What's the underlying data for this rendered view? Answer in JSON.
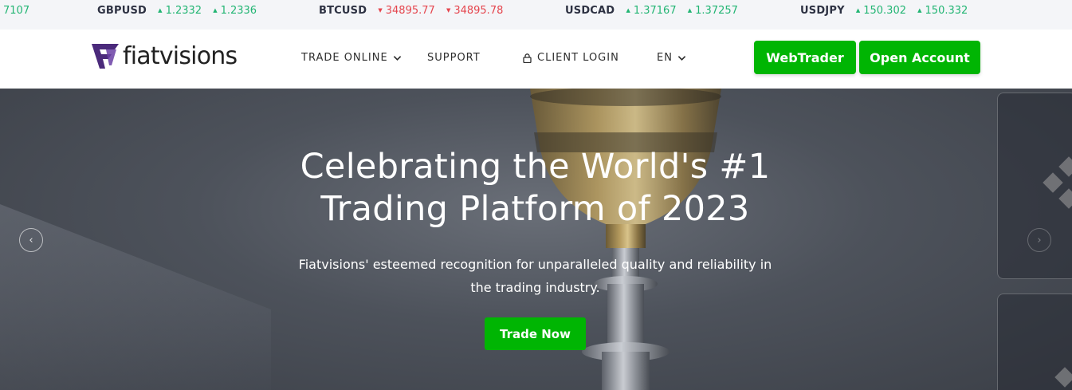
{
  "ticker": {
    "partial": "7107",
    "items": [
      {
        "symbol": "GBPUSD",
        "bid": "1.2332",
        "ask": "1.2336",
        "direction": "up"
      },
      {
        "symbol": "BTCUSD",
        "bid": "34895.77",
        "ask": "34895.78",
        "direction": "down"
      },
      {
        "symbol": "USDCAD",
        "bid": "1.37167",
        "ask": "1.37257",
        "direction": "up"
      },
      {
        "symbol": "USDJPY",
        "bid": "150.302",
        "ask": "150.332",
        "direction": "up"
      }
    ]
  },
  "header": {
    "brand": "fiatvisions",
    "nav": {
      "trade_online": "TRADE ONLINE",
      "support": "SUPPORT",
      "client_login": "CLIENT LOGIN",
      "language": "EN"
    },
    "webtrader": "WebTrader",
    "open_account": "Open Account"
  },
  "hero": {
    "title_line1": "Celebrating the World's #1",
    "title_line2": "Trading Platform of 2023",
    "subtitle_line1": "Fiatvisions' esteemed recognition for unparalleled quality and reliability in",
    "subtitle_line2": "the trading industry.",
    "cta": "Trade Now",
    "prev_arrow": "‹",
    "next_arrow": "›"
  },
  "colors": {
    "accent_green": "#00b503",
    "up": "#22b573",
    "down": "#e5464e",
    "brand_purple": "#4b2a7b"
  }
}
